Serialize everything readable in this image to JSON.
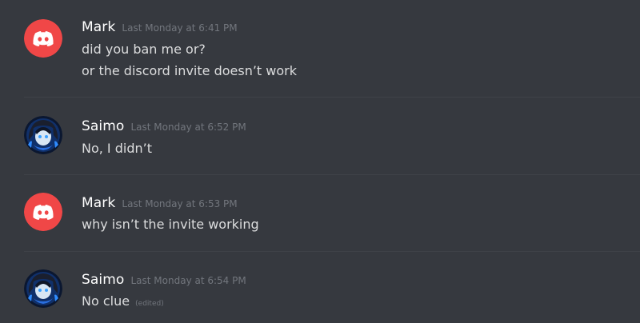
{
  "messages": [
    {
      "author": "Mark",
      "avatar": "discord-logo-icon",
      "avatar_color": "#f04747",
      "timestamp": "Last Monday at 6:41 PM",
      "lines": [
        "did you ban me or?",
        "or the discord invite doesn’t work"
      ]
    },
    {
      "author": "Saimo",
      "avatar": "user-avatar",
      "timestamp": "Last Monday at 6:52 PM",
      "lines": [
        "No, I didn’t"
      ]
    },
    {
      "author": "Mark",
      "avatar": "discord-logo-icon",
      "avatar_color": "#f04747",
      "timestamp": "Last Monday at 6:53 PM",
      "lines": [
        "why isn’t the invite working"
      ]
    },
    {
      "author": "Saimo",
      "avatar": "user-avatar",
      "timestamp": "Last Monday at 6:54 PM",
      "lines": [
        "No clue"
      ],
      "edited_label": "(edited)"
    }
  ],
  "colors": {
    "background": "#36393f",
    "username": "#ffffff",
    "message_text": "#dcddde",
    "timestamp": "#72767d",
    "divider": "#3f4248"
  }
}
